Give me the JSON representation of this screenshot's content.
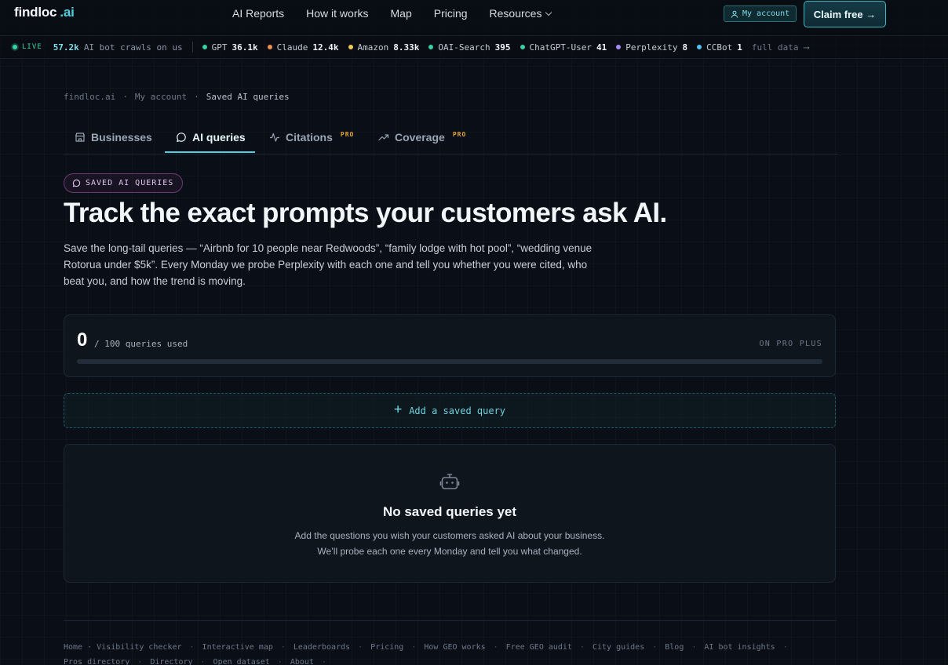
{
  "nav": {
    "logo_main": "findloc",
    "logo_ai": ".ai",
    "links": [
      "AI Reports",
      "How it works",
      "Map",
      "Pricing",
      "Resources"
    ],
    "my_account": "My account",
    "claim_free": "Claim free →"
  },
  "ticker": {
    "live": "LIVE",
    "count": "57.2k",
    "count_label": "AI bot crawls on us",
    "items": [
      {
        "name": "GPT",
        "value": "36.1k",
        "color": "#35d0a4"
      },
      {
        "name": "Claude",
        "value": "12.4k",
        "color": "#f0914a"
      },
      {
        "name": "Amazon",
        "value": "8.33k",
        "color": "#f2c94c"
      },
      {
        "name": "OAI-Search",
        "value": "395",
        "color": "#35d0a4"
      },
      {
        "name": "ChatGPT-User",
        "value": "41",
        "color": "#35d0a4"
      },
      {
        "name": "Perplexity",
        "value": "8",
        "color": "#a78bfa"
      },
      {
        "name": "CCBot",
        "value": "1",
        "color": "#4fc3f7"
      }
    ],
    "full_data": "full data ⟶"
  },
  "breadcrumb": [
    "findloc.ai",
    "My account",
    "Saved AI queries"
  ],
  "tabs": [
    {
      "label": "Businesses",
      "pro": ""
    },
    {
      "label": "AI queries",
      "pro": ""
    },
    {
      "label": "Citations",
      "pro": "PRO"
    },
    {
      "label": "Coverage",
      "pro": "PRO"
    }
  ],
  "hero": {
    "badge": "SAVED AI QUERIES",
    "title": "Track the exact prompts your customers ask AI.",
    "subtitle": "Save the long-tail queries — “Airbnb for 10 people near Redwoods”, “family lodge with hot pool”, “wedding venue Rotorua under $5k”. Every Monday we probe Perplexity with each one and tell you whether you were cited, who beat you, and how the trend is moving."
  },
  "usage": {
    "used": "0",
    "of_label": "/ 100 queries used",
    "plan": "ON PRO PLUS",
    "fraction": 0
  },
  "add_query": {
    "label": "Add a saved query"
  },
  "empty": {
    "title": "No saved queries yet",
    "line1": "Add the questions you wish your customers asked AI about your business.",
    "line2": "We’ll probe each one every Monday and tell you what changed."
  },
  "footer": {
    "row1": [
      "Home · Visibility checker",
      "Interactive map",
      "Leaderboards",
      "Pricing",
      "How GEO works",
      "Free GEO audit",
      "City guides",
      "Blog",
      "AI bot insights"
    ],
    "row2": [
      "Pros directory",
      "Directory",
      "Open dataset",
      "About"
    ]
  },
  "colors": {
    "accent": "#4fd1e1",
    "pro": "#e3a33a",
    "live": "#35d0a4"
  }
}
